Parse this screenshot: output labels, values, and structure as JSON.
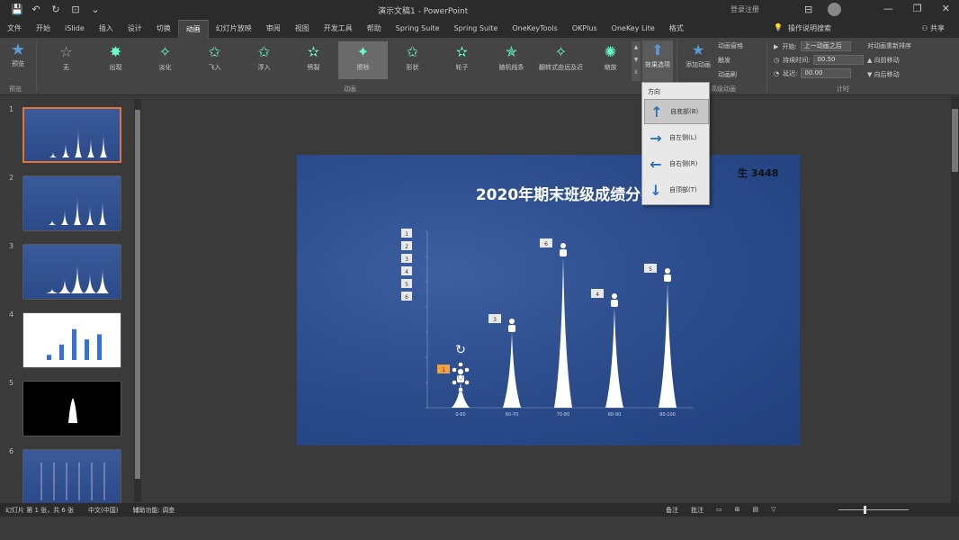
{
  "window": {
    "doc_title": "演示文稿1 - PowerPoint",
    "sign_in": "登录注册",
    "ribbon_display_icon": "ribbon-display-icon"
  },
  "tabs": [
    {
      "label": "文件"
    },
    {
      "label": "开始"
    },
    {
      "label": "iSlide"
    },
    {
      "label": "插入"
    },
    {
      "label": "设计"
    },
    {
      "label": "切换"
    },
    {
      "label": "动画"
    },
    {
      "label": "幻灯片放映"
    },
    {
      "label": "审阅"
    },
    {
      "label": "视图"
    },
    {
      "label": "开发工具"
    },
    {
      "label": "帮助"
    },
    {
      "label": "Spring Suite"
    },
    {
      "label": "Spring Suite"
    },
    {
      "label": "OneKeyTools"
    },
    {
      "label": "OKPlus"
    },
    {
      "label": "OneKey Lite"
    },
    {
      "label": "格式"
    }
  ],
  "active_tab_index": 6,
  "tell_me": "操作说明搜索",
  "share": "共享",
  "ribbon": {
    "preview_label": "预览",
    "preview_group": "预览",
    "animations_group": "动画",
    "animations": [
      {
        "name": "无",
        "glyph": "☆",
        "grey": true
      },
      {
        "name": "出现",
        "glyph": "✸"
      },
      {
        "name": "淡化",
        "glyph": "✧"
      },
      {
        "name": "飞入",
        "glyph": "✩"
      },
      {
        "name": "浮入",
        "glyph": "✩"
      },
      {
        "name": "劈裂",
        "glyph": "✫"
      },
      {
        "name": "擦除",
        "glyph": "✦"
      },
      {
        "name": "形状",
        "glyph": "✩"
      },
      {
        "name": "轮子",
        "glyph": "✫"
      },
      {
        "name": "随机线条",
        "glyph": "✯"
      },
      {
        "name": "翻转式由远及近",
        "glyph": "✧"
      },
      {
        "name": "缩放",
        "glyph": "✺"
      }
    ],
    "selected_animation": 6,
    "effect_options_label": "效果选项",
    "add_animation_label": "添加动画",
    "advanced": [
      "动画窗格",
      "触发",
      "动画刷"
    ],
    "advanced_group": "高级动画",
    "timing": {
      "start_label": "开始:",
      "start_value": "上一动画之后",
      "duration_label": "持续时间:",
      "duration_value": "00.50",
      "delay_label": "延迟:",
      "delay_value": "00.00",
      "group": "计时"
    },
    "reorder": [
      "对动画重新排序",
      "▲ 向前移动",
      "▼ 向后移动"
    ]
  },
  "dropdown": {
    "header": "方向",
    "items": [
      {
        "label": "自底部(B)",
        "arrow": "↑"
      },
      {
        "label": "自左侧(L)",
        "arrow": "→"
      },
      {
        "label": "自右侧(R)",
        "arrow": "←"
      },
      {
        "label": "自顶部(T)",
        "arrow": "↓"
      }
    ],
    "selected_index": 0
  },
  "slides": [
    {
      "num": "1"
    },
    {
      "num": "2"
    },
    {
      "num": "3"
    },
    {
      "num": "4"
    },
    {
      "num": "5"
    },
    {
      "num": "6"
    }
  ],
  "slide": {
    "title": "2020年期末班级成绩分布图",
    "logo": "生 3448"
  },
  "chart_data": {
    "type": "bar",
    "title": "2020年期末班级成绩分布图",
    "categories": [
      "0-60",
      "60-70",
      "70-80",
      "80-90",
      "90-100"
    ],
    "values": [
      1,
      3,
      6,
      4,
      5
    ],
    "ylim": [
      0,
      7
    ],
    "legend_labels": [
      "1",
      "2",
      "3",
      "4",
      "5",
      "6"
    ]
  },
  "status": {
    "left": [
      "幻灯片 第 1 张，共 6 张",
      "中文(中国)",
      "辅助功能: 调查"
    ],
    "right": [
      "备注",
      "批注"
    ],
    "notes_icon": "notes-icon"
  }
}
